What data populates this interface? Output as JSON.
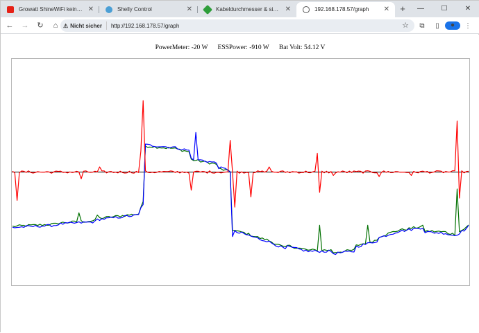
{
  "browser": {
    "tabs": [
      {
        "title": "Growatt ShineWiFi keine Cloud",
        "icon": "youtube-icon",
        "active": false
      },
      {
        "title": "Shelly Control",
        "icon": "shelly-icon",
        "active": false
      },
      {
        "title": "Kabeldurchmesser & sicherung",
        "icon": "leaf-icon",
        "active": false
      },
      {
        "title": "192.168.178.57/graph",
        "icon": "globe-icon",
        "active": true
      }
    ],
    "new_tab": "+",
    "security_label": "Nicht sicher",
    "url": "http://192.168.178.57/graph"
  },
  "readings": {
    "power_meter_label": "PowerMeter:",
    "power_meter_value": "-20 W",
    "ess_label": "ESSPower:",
    "ess_value": "-910 W",
    "bat_label": "Bat Volt:",
    "bat_value": "54.12 V"
  },
  "chart_data": {
    "type": "line",
    "title": "",
    "xlabel": "",
    "ylabel": "",
    "ylim": [
      -1000,
      1000
    ],
    "zero_line": true,
    "grid": false,
    "legend": "none",
    "x_count": 200,
    "series": [
      {
        "color": "#ff0000",
        "segments": [
          [
            0,
            0,
            1
          ]
        ],
        "spikes": [
          [
            2,
            -250
          ],
          [
            30,
            -60
          ],
          [
            38,
            45
          ],
          [
            56,
            185
          ],
          [
            57,
            630
          ],
          [
            78,
            -160
          ],
          [
            95,
            280
          ],
          [
            97,
            -310
          ],
          [
            103,
            -5
          ],
          [
            104,
            -220
          ],
          [
            112,
            45
          ],
          [
            133,
            165
          ],
          [
            134,
            -180
          ],
          [
            140,
            -30
          ],
          [
            160,
            -40
          ],
          [
            174,
            -30
          ],
          [
            194,
            450
          ],
          [
            195,
            -230
          ]
        ]
      },
      {
        "color": "#0000ff",
        "segments": [
          [
            0,
            -490,
            -470
          ],
          [
            20,
            -460,
            -440
          ],
          [
            37,
            -420,
            -380
          ],
          [
            56,
            -320,
            -300
          ],
          [
            57,
            -280,
            -260
          ],
          [
            58,
            240,
            220
          ],
          [
            70,
            220,
            190
          ],
          [
            78,
            120,
            80
          ],
          [
            90,
            40,
            20
          ],
          [
            95,
            10,
            0
          ],
          [
            96,
            -520,
            -540
          ],
          [
            100,
            -540,
            -600
          ],
          [
            110,
            -600,
            -680
          ],
          [
            120,
            -660,
            -700
          ],
          [
            130,
            -700,
            -700
          ],
          [
            140,
            -720,
            -700
          ],
          [
            150,
            -660,
            -610
          ],
          [
            160,
            -580,
            -520
          ],
          [
            170,
            -520,
            -490
          ],
          [
            180,
            -530,
            -540
          ],
          [
            190,
            -550,
            -560
          ],
          [
            194,
            -550,
            -500
          ],
          [
            199,
            -480,
            -490
          ]
        ],
        "spikes": [
          [
            80,
            350
          ],
          [
            96,
            -570
          ]
        ]
      },
      {
        "color": "#007000",
        "segments": [
          [
            0,
            -480,
            -460
          ],
          [
            20,
            -450,
            -430
          ],
          [
            37,
            -410,
            -370
          ],
          [
            56,
            -310,
            -290
          ],
          [
            57,
            -270,
            -250
          ],
          [
            58,
            230,
            210
          ],
          [
            70,
            210,
            180
          ],
          [
            78,
            110,
            70
          ],
          [
            90,
            30,
            10
          ],
          [
            95,
            0,
            -10
          ],
          [
            96,
            -510,
            -530
          ],
          [
            100,
            -530,
            -590
          ],
          [
            110,
            -590,
            -670
          ],
          [
            120,
            -650,
            -690
          ],
          [
            130,
            -690,
            -690
          ],
          [
            140,
            -710,
            -690
          ],
          [
            150,
            -650,
            -600
          ],
          [
            160,
            -570,
            -510
          ],
          [
            170,
            -510,
            -480
          ],
          [
            180,
            -520,
            -530
          ],
          [
            190,
            -540,
            -550
          ],
          [
            194,
            -540,
            -490
          ],
          [
            199,
            -470,
            -480
          ]
        ],
        "spikes": [
          [
            29,
            -360
          ],
          [
            37,
            -380
          ],
          [
            134,
            -470
          ],
          [
            155,
            -470
          ],
          [
            194,
            -150
          ]
        ]
      }
    ]
  }
}
